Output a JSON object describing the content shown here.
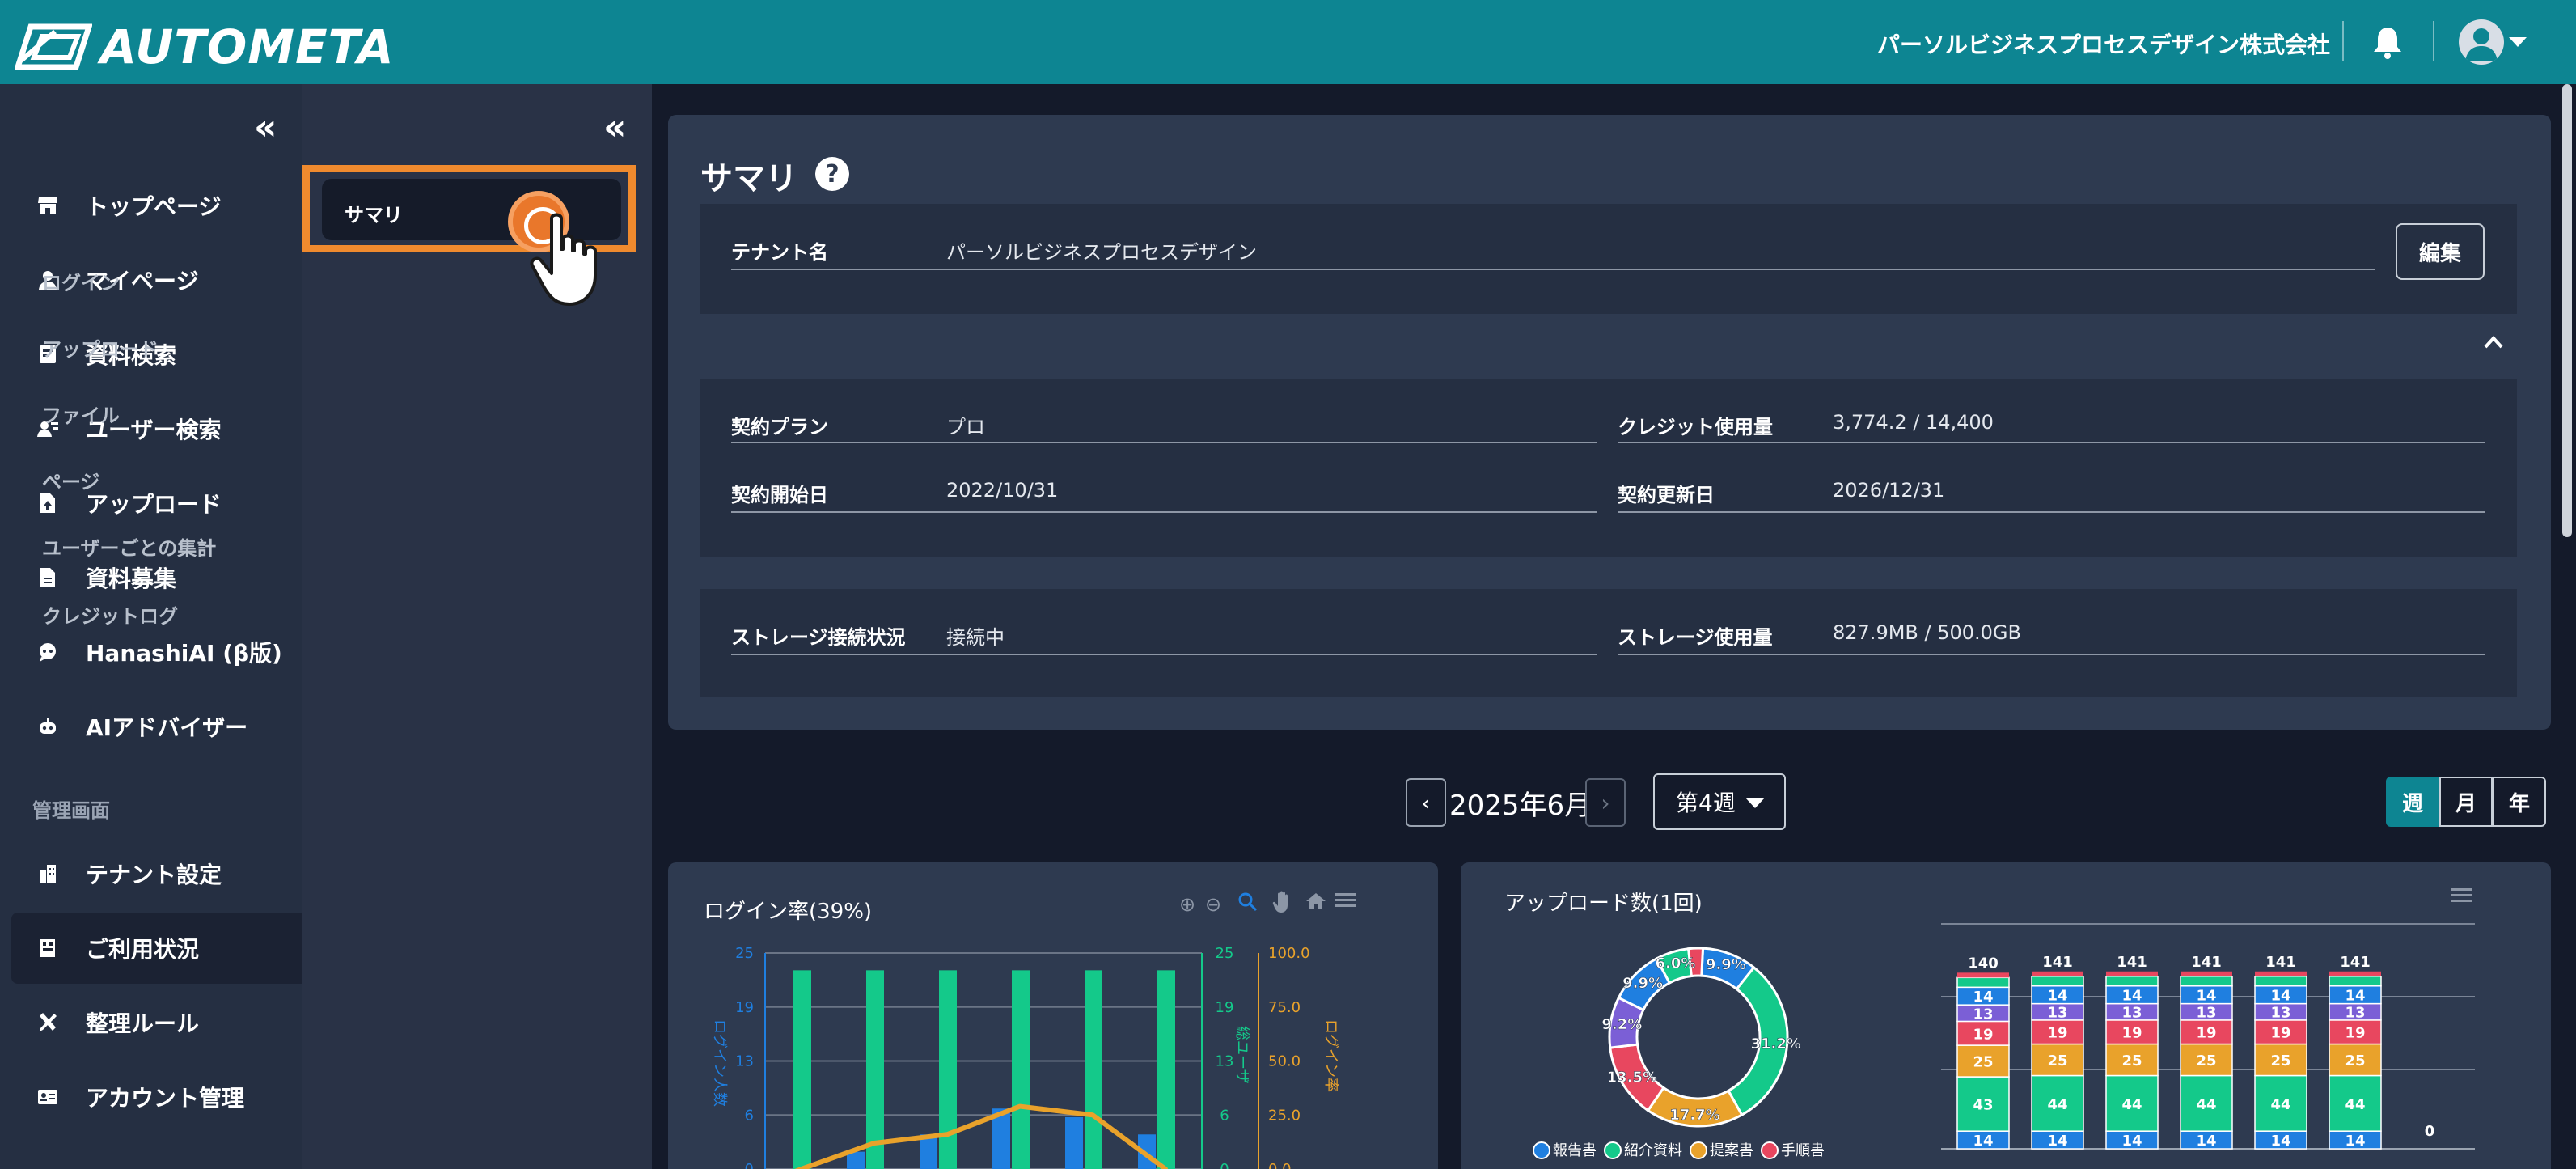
{
  "app": {
    "brand": "AUTOMETA",
    "company": "パーソルビジネスプロセスデザイン株式会社"
  },
  "leftnav": {
    "items": [
      {
        "label": "トップページ",
        "icon": "store-icon"
      },
      {
        "label": "マイページ",
        "icon": "user-icon"
      },
      {
        "label": "資料検索",
        "icon": "document-search-icon"
      },
      {
        "label": "ユーザー検索",
        "icon": "user-search-icon"
      },
      {
        "label": "アップロード",
        "icon": "file-upload-icon"
      },
      {
        "label": "資料募集",
        "icon": "file-icon"
      },
      {
        "label": "HanashiAI (β版)",
        "icon": "chat-bot-icon"
      },
      {
        "label": "AIアドバイザー",
        "icon": "robot-icon"
      }
    ],
    "section": "管理画面",
    "admin_items": [
      {
        "label": "テナント設定",
        "icon": "building-icon"
      },
      {
        "label": "ご利用状況",
        "icon": "usage-icon"
      },
      {
        "label": "整理ルール",
        "icon": "tools-icon"
      },
      {
        "label": "アカウント管理",
        "icon": "id-card-icon"
      }
    ]
  },
  "subnav": {
    "active": "サマリ",
    "items": [
      "ログイン",
      "アップロード",
      "ファイル",
      "ページ",
      "ユーザーごとの集計",
      "クレジットログ"
    ]
  },
  "summary": {
    "title": "サマリ",
    "tenant_label": "テナント名",
    "tenant_value": "パーソルビジネスプロセスデザイン",
    "edit_label": "編集",
    "plan_label": "契約プラン",
    "plan_value": "プロ",
    "credit_label": "クレジット使用量",
    "credit_value": "3,774.2 / 14,400",
    "start_label": "契約開始日",
    "start_value": "2022/10/31",
    "renew_label": "契約更新日",
    "renew_value": "2026/12/31",
    "storage_conn_label": "ストレージ接続状況",
    "storage_conn_value": "接続中",
    "storage_use_label": "ストレージ使用量",
    "storage_use_value": "827.9MB / 500.0GB"
  },
  "period": {
    "label": "2025年6月",
    "week": "第4週",
    "toggle": [
      "週",
      "月",
      "年"
    ],
    "selected": "週"
  },
  "colors": {
    "accent": "#0d8592",
    "highlight": "#ef8a2e",
    "blue": "#1f7fe0",
    "green": "#14c98a",
    "orange": "#e9a22b",
    "red": "#e8475f",
    "purple": "#7b5fd6"
  },
  "chart_data": [
    {
      "type": "bar",
      "title": "ログイン率(39%)",
      "ylabel_left": "ログイン人数",
      "ylabel_mid": "総ユーザ",
      "ylabel_right": "ログイン率",
      "left_ticks": [
        "25",
        "19",
        "13",
        "6",
        "0"
      ],
      "mid_ticks": [
        "25",
        "19",
        "13",
        "6",
        "0"
      ],
      "right_ticks": [
        "100.0",
        "75.0",
        "50.0",
        "25.0",
        "0.0"
      ],
      "series": [
        {
          "name": "総ユーザ",
          "values": [
            23,
            23,
            23,
            23,
            23,
            23
          ]
        },
        {
          "name": "ログイン人数",
          "values": [
            0,
            2,
            4,
            7,
            6,
            4
          ]
        },
        {
          "name": "ログイン率",
          "values": [
            0,
            12,
            16,
            29,
            25,
            0
          ]
        }
      ],
      "ylim": [
        0,
        25
      ],
      "y2lim": [
        0,
        100
      ]
    },
    {
      "type": "pie",
      "title": "アップロード数(1回)",
      "legend": [
        "報告書",
        "紹介資料",
        "提案書",
        "手順書"
      ],
      "slice_labels": [
        "9.9%",
        "31.2%",
        "17.7%",
        "13.5%",
        "9.2%",
        "9.9%",
        "6.0%"
      ],
      "values": [
        9.9,
        31.2,
        17.7,
        13.5,
        9.2,
        9.9,
        6.0,
        2.6
      ],
      "slice_colors": [
        "#1f7fe0",
        "#14c98a",
        "#e9a22b",
        "#e8475f",
        "#7b5fd6",
        "#1f7fe0",
        "#14c98a",
        "#e8475f"
      ]
    },
    {
      "type": "bar",
      "stacked": true,
      "totals": [
        "140",
        "141",
        "141",
        "141",
        "141",
        "141",
        "0"
      ],
      "series": [
        {
          "name": "報告書",
          "values": [
            14,
            14,
            14,
            14,
            14,
            14,
            0
          ]
        },
        {
          "name": "紹介資料",
          "values": [
            43,
            44,
            44,
            44,
            44,
            44,
            0
          ]
        },
        {
          "name": "提案書",
          "values": [
            25,
            25,
            25,
            25,
            25,
            25,
            0
          ]
        },
        {
          "name": "手順書",
          "values": [
            19,
            19,
            19,
            19,
            19,
            19,
            0
          ]
        },
        {
          "name": "",
          "values": [
            13,
            13,
            13,
            13,
            13,
            13,
            0
          ]
        },
        {
          "name": "",
          "values": [
            14,
            14,
            14,
            14,
            14,
            14,
            0
          ]
        }
      ]
    }
  ]
}
